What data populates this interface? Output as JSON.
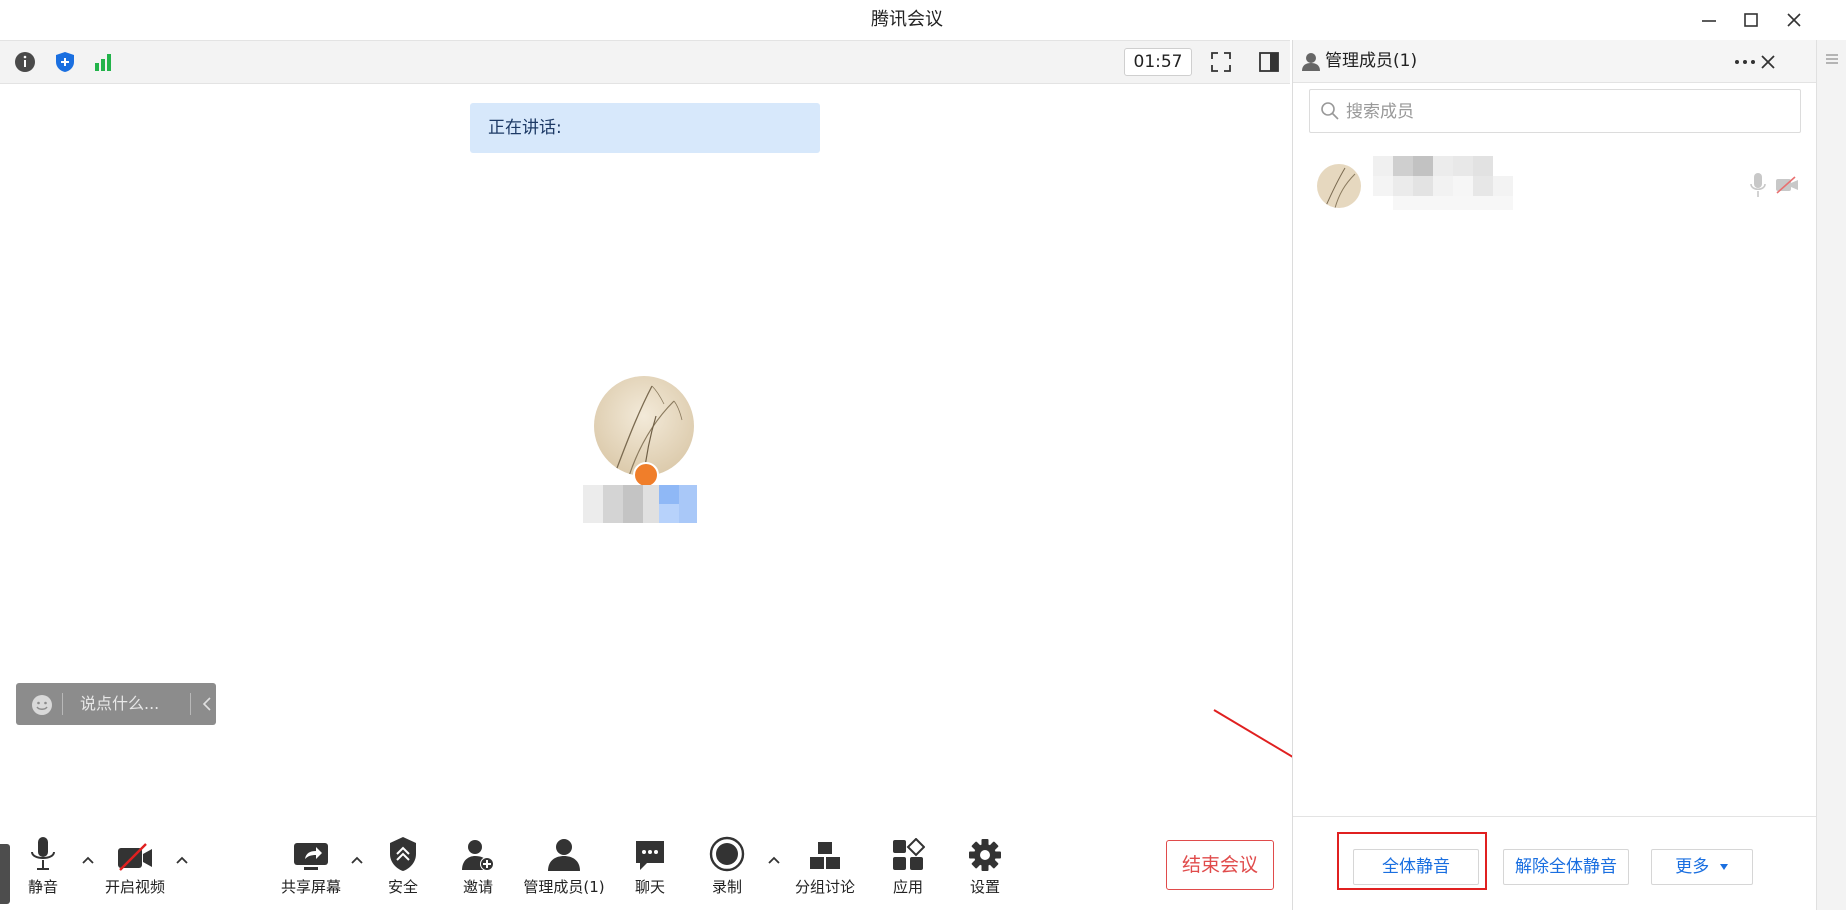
{
  "window": {
    "title": "腾讯会议"
  },
  "toolbar": {
    "timer": "01:57"
  },
  "stage": {
    "speaking_label": "正在讲话:"
  },
  "chat": {
    "placeholder": "说点什么..."
  },
  "bottom_toolbar": {
    "mute": "静音",
    "video": "开启视频",
    "share": "共享屏幕",
    "security": "安全",
    "invite": "邀请",
    "manage": "管理成员(1)",
    "chat": "聊天",
    "record": "录制",
    "breakout": "分组讨论",
    "apps": "应用",
    "settings": "设置",
    "end": "结束会议"
  },
  "members_panel": {
    "title": "管理成员(1)",
    "search_placeholder": "搜索成员",
    "footer": {
      "mute_all": "全体静音",
      "unmute_all": "解除全体静音",
      "more": "更多"
    }
  },
  "colors": {
    "accent_blue": "#1a6fe0",
    "end_red": "#e04b4b",
    "annotation_red": "#e02020",
    "speaking_bg": "#d7e8fb"
  }
}
